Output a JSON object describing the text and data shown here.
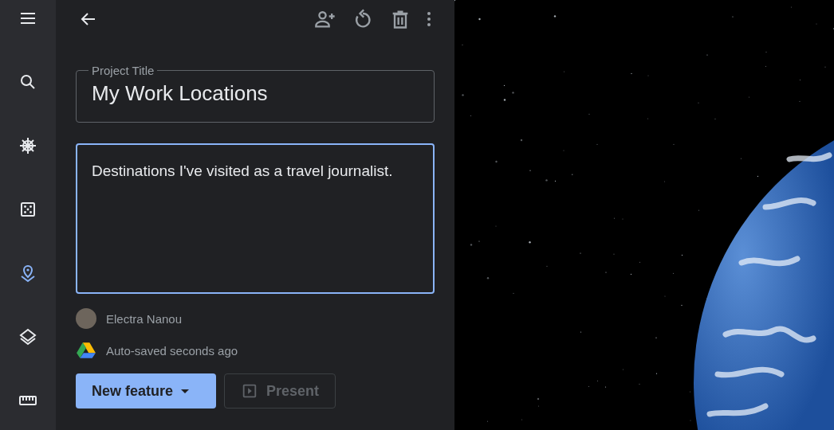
{
  "rail": [
    {
      "kind": "menu",
      "selected": false
    },
    {
      "kind": "search",
      "selected": false
    },
    {
      "kind": "voyager",
      "selected": false
    },
    {
      "kind": "dice",
      "selected": false
    },
    {
      "kind": "projects",
      "selected": true
    },
    {
      "kind": "layers",
      "selected": false
    },
    {
      "kind": "ruler",
      "selected": false
    }
  ],
  "toolbar": {
    "actions": [
      {
        "kind": "share"
      },
      {
        "kind": "undo"
      },
      {
        "kind": "delete"
      },
      {
        "kind": "more"
      }
    ]
  },
  "title_field": {
    "label": "Project Title",
    "value": "My Work Locations"
  },
  "description_field": {
    "value": "Destinations I've visited as a travel journalist.",
    "focused": true
  },
  "owner": {
    "name": "Electra Nanou"
  },
  "save_status": {
    "text": "Auto-saved seconds ago"
  },
  "buttons": [
    {
      "kind": "primary",
      "label": "New feature",
      "disabled": false
    },
    {
      "kind": "present",
      "label": "Present",
      "disabled": true
    }
  ]
}
